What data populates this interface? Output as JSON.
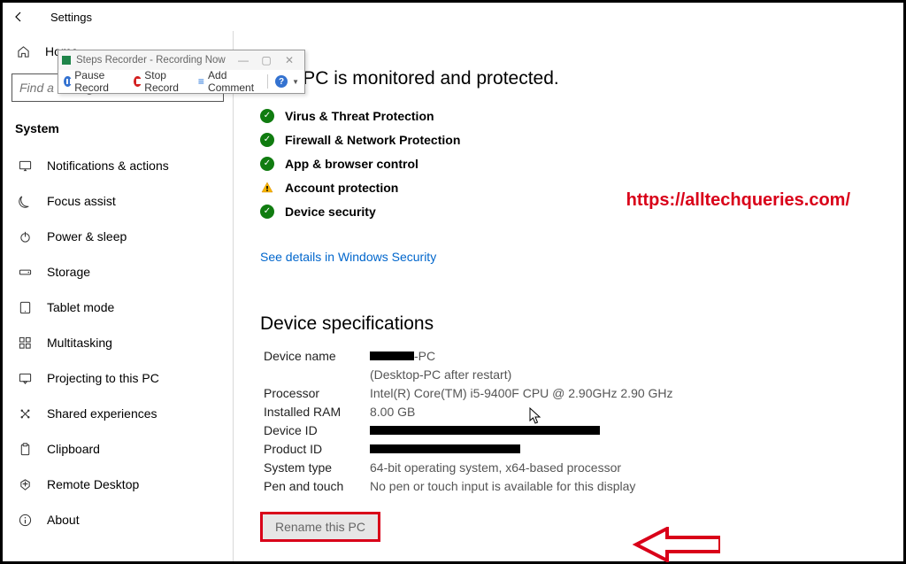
{
  "window": {
    "title": "Settings",
    "home": "Home"
  },
  "search": {
    "placeholder": "Find a setting"
  },
  "side_group": "System",
  "sidebar": {
    "items": [
      {
        "label": "Notifications & actions"
      },
      {
        "label": "Focus assist"
      },
      {
        "label": "Power & sleep"
      },
      {
        "label": "Storage"
      },
      {
        "label": "Tablet mode"
      },
      {
        "label": "Multitasking"
      },
      {
        "label": "Projecting to this PC"
      },
      {
        "label": "Shared experiences"
      },
      {
        "label": "Clipboard"
      },
      {
        "label": "Remote Desktop"
      },
      {
        "label": "About"
      }
    ]
  },
  "security": {
    "heading": "Your PC is monitored and protected.",
    "items": [
      {
        "status": "ok",
        "label": "Virus & Threat Protection"
      },
      {
        "status": "ok",
        "label": "Firewall & Network Protection"
      },
      {
        "status": "ok",
        "label": "App & browser control"
      },
      {
        "status": "warn",
        "label": "Account protection"
      },
      {
        "status": "ok",
        "label": "Device security"
      }
    ],
    "details_link": "See details in Windows Security"
  },
  "specs": {
    "title": "Device specifications",
    "device_name_label": "Device name",
    "device_name_value_suffix": "-PC",
    "device_name_note": "(Desktop-PC after restart)",
    "processor_label": "Processor",
    "processor_value": "Intel(R) Core(TM) i5-9400F CPU @ 2.90GHz   2.90 GHz",
    "ram_label": "Installed RAM",
    "ram_value": "8.00 GB",
    "device_id_label": "Device ID",
    "product_id_label": "Product ID",
    "system_type_label": "System type",
    "system_type_value": "64-bit operating system, x64-based processor",
    "pen_label": "Pen and touch",
    "pen_value": "No pen or touch input is available for this display",
    "rename_btn": "Rename this PC"
  },
  "watermark": "https://alltechqueries.com/",
  "recorder": {
    "title": "Steps Recorder - Recording Now",
    "pause": "Pause Record",
    "stop": "Stop Record",
    "add": "Add Comment"
  }
}
